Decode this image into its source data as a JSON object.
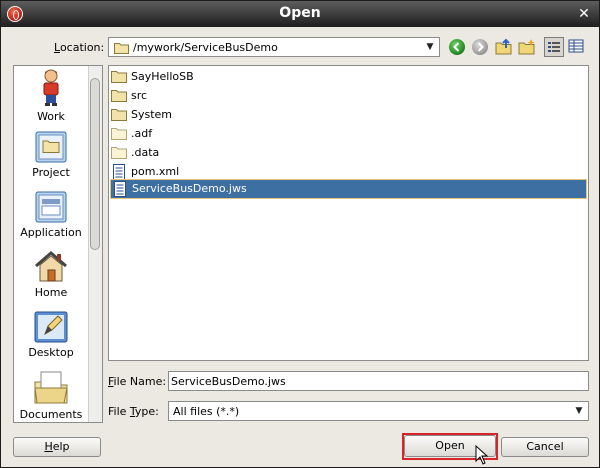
{
  "window": {
    "title": "Open"
  },
  "location": {
    "label_pre": "",
    "label_underline": "L",
    "label_post": "ocation:",
    "path": "/mywork/ServiceBusDemo"
  },
  "places": [
    {
      "label": "Work"
    },
    {
      "label": "Project"
    },
    {
      "label": "Application"
    },
    {
      "label": "Home"
    },
    {
      "label": "Desktop"
    },
    {
      "label": "Documents"
    }
  ],
  "files": [
    {
      "name": "SayHelloSB",
      "type": "folder"
    },
    {
      "name": "src",
      "type": "folder"
    },
    {
      "name": "System",
      "type": "folder"
    },
    {
      "name": ".adf",
      "type": "folder"
    },
    {
      "name": ".data",
      "type": "folder"
    },
    {
      "name": "pom.xml",
      "type": "file"
    },
    {
      "name": "ServiceBusDemo.jws",
      "type": "file",
      "selected": true
    }
  ],
  "file_name": {
    "label_underline": "F",
    "label_post": "ile Name:",
    "value": "ServiceBusDemo.jws"
  },
  "file_type": {
    "label_pre": "File ",
    "label_underline": "T",
    "label_post": "ype:",
    "value": "All files (*.*)"
  },
  "buttons": {
    "help_underline": "H",
    "help_post": "elp",
    "open": "Open",
    "cancel": "Cancel"
  },
  "colors": {
    "selection": "#3e6fa2",
    "highlight": "#d7232a",
    "titlebar": "#2a2a2a"
  }
}
